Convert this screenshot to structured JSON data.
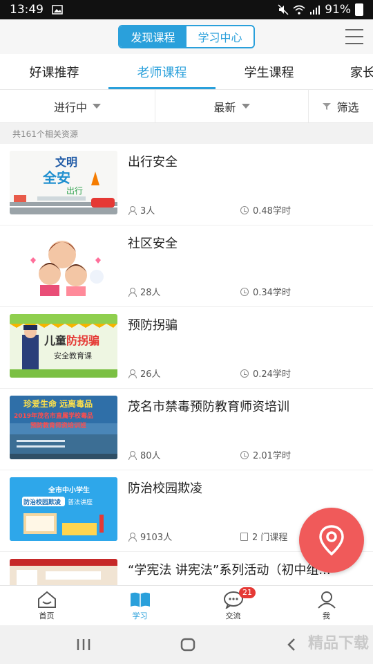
{
  "status_bar": {
    "time": "13:49",
    "battery_pct": "91%"
  },
  "header": {
    "seg_active": "发现课程",
    "seg_inactive": "学习中心"
  },
  "tabs": [
    {
      "label": "好课推荐"
    },
    {
      "label": "老师课程"
    },
    {
      "label": "学生课程"
    },
    {
      "label": "家长"
    }
  ],
  "filters": {
    "status": "进行中",
    "sort": "最新",
    "filter": "筛选"
  },
  "result_count": "共161个相关资源",
  "courses": [
    {
      "title": "出行安全",
      "learners": "3人",
      "duration": "0.48学时",
      "thumb_text": "文明交通 全安 出行"
    },
    {
      "title": "社区安全",
      "learners": "28人",
      "duration": "0.34学时",
      "thumb_text": ""
    },
    {
      "title": "预防拐骗",
      "learners": "26人",
      "duration": "0.24学时",
      "thumb_text": "儿童防拐骗 安全教育课"
    },
    {
      "title": "茂名市禁毒预防教育师资培训",
      "learners": "80人",
      "duration": "2.01学时",
      "thumb_text": "珍爱生命 远离毒品"
    },
    {
      "title": "防治校园欺凌",
      "learners": "9103人",
      "duration": "2 门课程",
      "thumb_text": "全市中小学生 防治校园欺凌 普法讲座"
    },
    {
      "title": "“学宪法 讲宪法”系列活动（初中组...",
      "learners": "",
      "duration": "",
      "thumb_text": ""
    }
  ],
  "bottom_nav": [
    {
      "label": "首页",
      "icon": "home-icon"
    },
    {
      "label": "学习",
      "icon": "book-icon"
    },
    {
      "label": "交流",
      "icon": "chat-icon",
      "badge": "21"
    },
    {
      "label": "我",
      "icon": "user-icon"
    }
  ],
  "watermark": "精品下载",
  "colors": {
    "accent": "#2aa0db",
    "fab": "#f05a5a",
    "badge": "#e53935"
  }
}
